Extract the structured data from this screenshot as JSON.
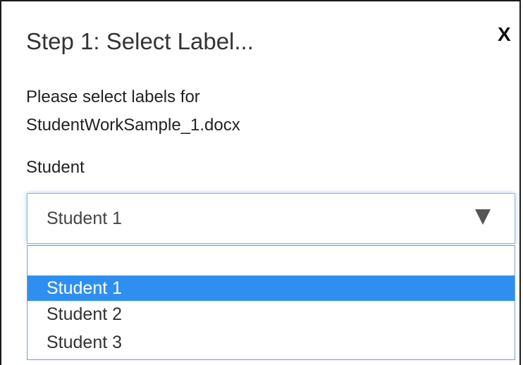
{
  "dialog": {
    "title": "Step 1: Select Label...",
    "close_label": "X",
    "instruction_line1": "Please select labels for",
    "instruction_line2": "StudentWorkSample_1.docx"
  },
  "student_field": {
    "label": "Student",
    "selected_value": "Student 1",
    "options": [
      {
        "label": ""
      },
      {
        "label": "Student 1",
        "highlighted": true
      },
      {
        "label": "Student 2"
      },
      {
        "label": "Student 3"
      }
    ]
  },
  "colors": {
    "highlight": "#2f8ff0",
    "focus_border": "#8fb8e6",
    "arrow": "#555555"
  },
  "icons": {
    "dropdown_arrow": "triangle-down-icon",
    "close": "close-icon"
  }
}
